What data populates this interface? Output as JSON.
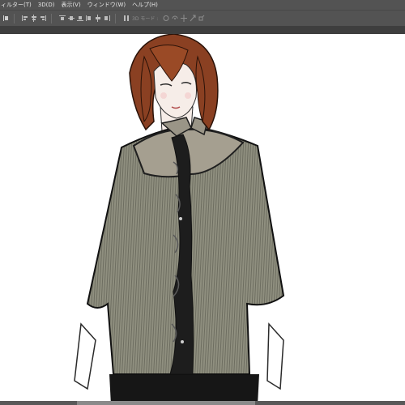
{
  "menu": {
    "filter": "ィルター(T)",
    "three_d": "3D(D)",
    "view": "表示(V)",
    "window": "ウィンドウ(W)",
    "help": "ヘルプ(H)"
  },
  "options_bar": {
    "mode_3d_label": "3D モード :",
    "icons": [
      "transform-controls-icon",
      "align-left-icon",
      "align-center-icon",
      "align-right-icon",
      "distribute-top-icon",
      "distribute-middle-icon",
      "distribute-bottom-icon",
      "distribute-left-icon",
      "distribute-center-icon",
      "distribute-right-icon",
      "3d-rotate-icon",
      "3d-roll-icon",
      "3d-pan-icon",
      "3d-slide-icon",
      "3d-scale-icon"
    ]
  },
  "colors": {
    "ui_dark": "#535353",
    "panel_gap": "#3e3e3e",
    "canvas": "#ffffff",
    "shirt": "#8f8f7f",
    "yoke": "#a59f90",
    "hair": "#8a4022",
    "lace": "#1d1d1d"
  }
}
